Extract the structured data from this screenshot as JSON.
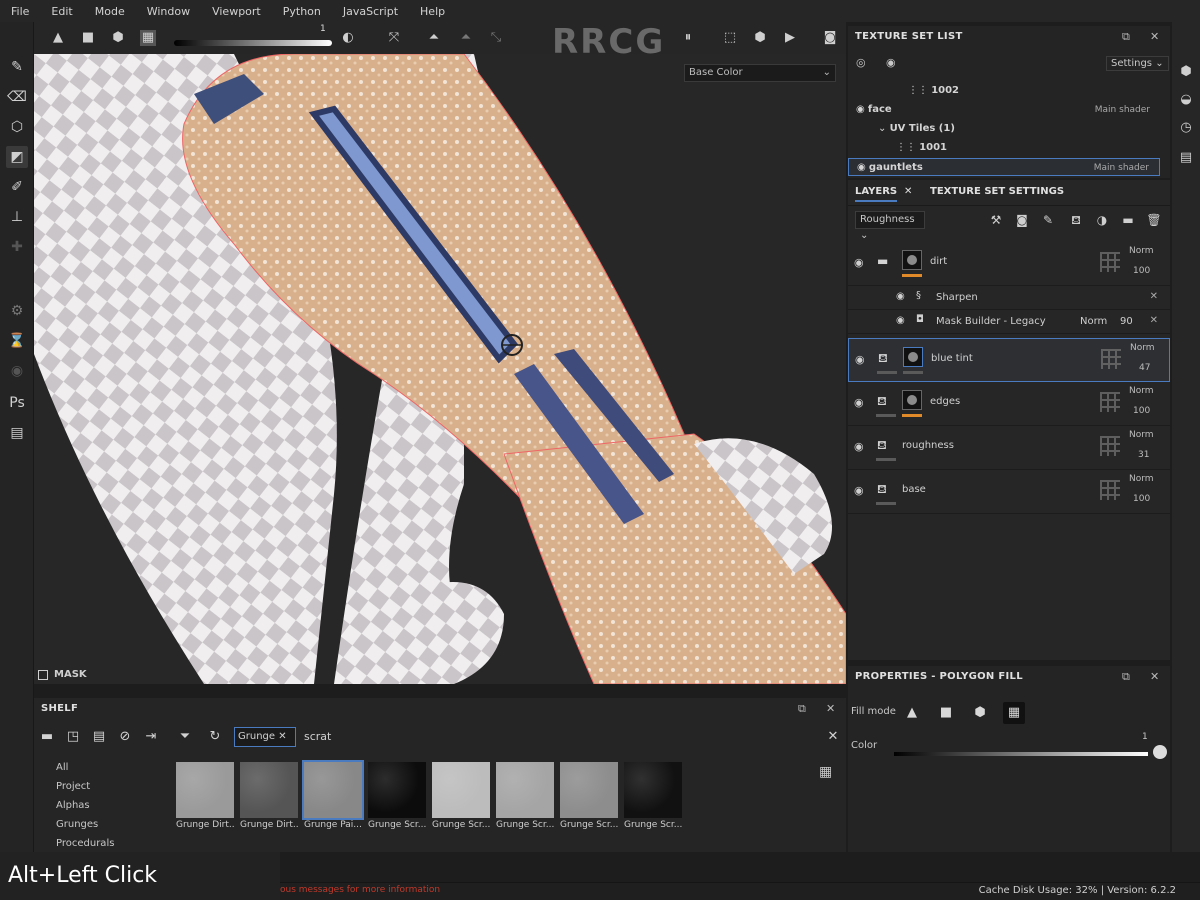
{
  "menu": [
    "File",
    "Edit",
    "Mode",
    "Window",
    "Viewport",
    "Python",
    "JavaScript",
    "Help"
  ],
  "toolbar": {
    "brand": "RRCG",
    "slider_value": "1"
  },
  "viewport": {
    "channel": "Base Color",
    "mask_label": "MASK"
  },
  "texture_set_list": {
    "title": "TEXTURE SET LIST",
    "settings_label": "Settings",
    "rows": [
      {
        "label": "1002",
        "shader": ""
      },
      {
        "label": "face",
        "shader": "Main shader"
      },
      {
        "label": "UV Tiles (1)",
        "shader": ""
      },
      {
        "label": "1001",
        "shader": ""
      },
      {
        "label": "gauntlets",
        "shader": "Main shader"
      }
    ]
  },
  "layers": {
    "tab_layers": "LAYERS",
    "tab_settings": "TEXTURE SET SETTINGS",
    "channel": "Roughness",
    "items": [
      {
        "name": "dirt",
        "blend": "Norm",
        "opacity": "100"
      },
      {
        "name": "blue tint",
        "blend": "Norm",
        "opacity": "47"
      },
      {
        "name": "edges",
        "blend": "Norm",
        "opacity": "100"
      },
      {
        "name": "roughness",
        "blend": "Norm",
        "opacity": "31"
      },
      {
        "name": "base",
        "blend": "Norm",
        "opacity": "100"
      }
    ],
    "sub_effects": [
      {
        "name": "Sharpen",
        "blend": "",
        "opacity": ""
      },
      {
        "name": "Mask Builder - Legacy",
        "blend": "Norm",
        "opacity": "90"
      }
    ]
  },
  "properties": {
    "title": "PROPERTIES - POLYGON FILL",
    "fill_mode_label": "Fill mode",
    "color_label": "Color",
    "color_value": "1"
  },
  "shelf": {
    "title": "SHELF",
    "filter_tag": "Grunge",
    "search": "scrat",
    "categories": [
      "All",
      "Project",
      "Alphas",
      "Grunges",
      "Procedurals"
    ],
    "resources": [
      {
        "name": "Grunge Dirt...",
        "tone": "#9a9a9a"
      },
      {
        "name": "Grunge Dirt...",
        "tone": "#555"
      },
      {
        "name": "Grunge Pai...",
        "tone": "#888"
      },
      {
        "name": "Grunge Scr...",
        "tone": "#0c0c0c"
      },
      {
        "name": "Grunge Scr...",
        "tone": "#bcbcbc"
      },
      {
        "name": "Grunge Scr...",
        "tone": "#a5a5a5"
      },
      {
        "name": "Grunge Scr...",
        "tone": "#8d8d8d"
      },
      {
        "name": "Grunge Scr...",
        "tone": "#111"
      }
    ]
  },
  "status": {
    "message": "ous messages for more information",
    "cache": "Cache Disk Usage:",
    "cache_value": "32%",
    "version": "| Version: 6.2.2"
  },
  "tooltip": "Alt+Left Click"
}
